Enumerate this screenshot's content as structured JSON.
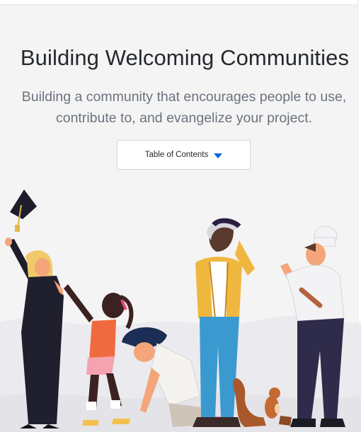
{
  "hero": {
    "title": "Building Welcoming Communities",
    "subtitle_line1": "Building a community that encourages people to use,",
    "subtitle_line2": "contribute to, and evangelize your project."
  },
  "toc": {
    "label": "Table of Contents",
    "caret_icon": "caret-down-icon",
    "accent_color": "#0366d6"
  },
  "illustration": {
    "figures": [
      "graduate-person",
      "child-runner",
      "kneeling-person",
      "man-in-yellow-cardigan",
      "chef",
      "squirrel"
    ]
  }
}
